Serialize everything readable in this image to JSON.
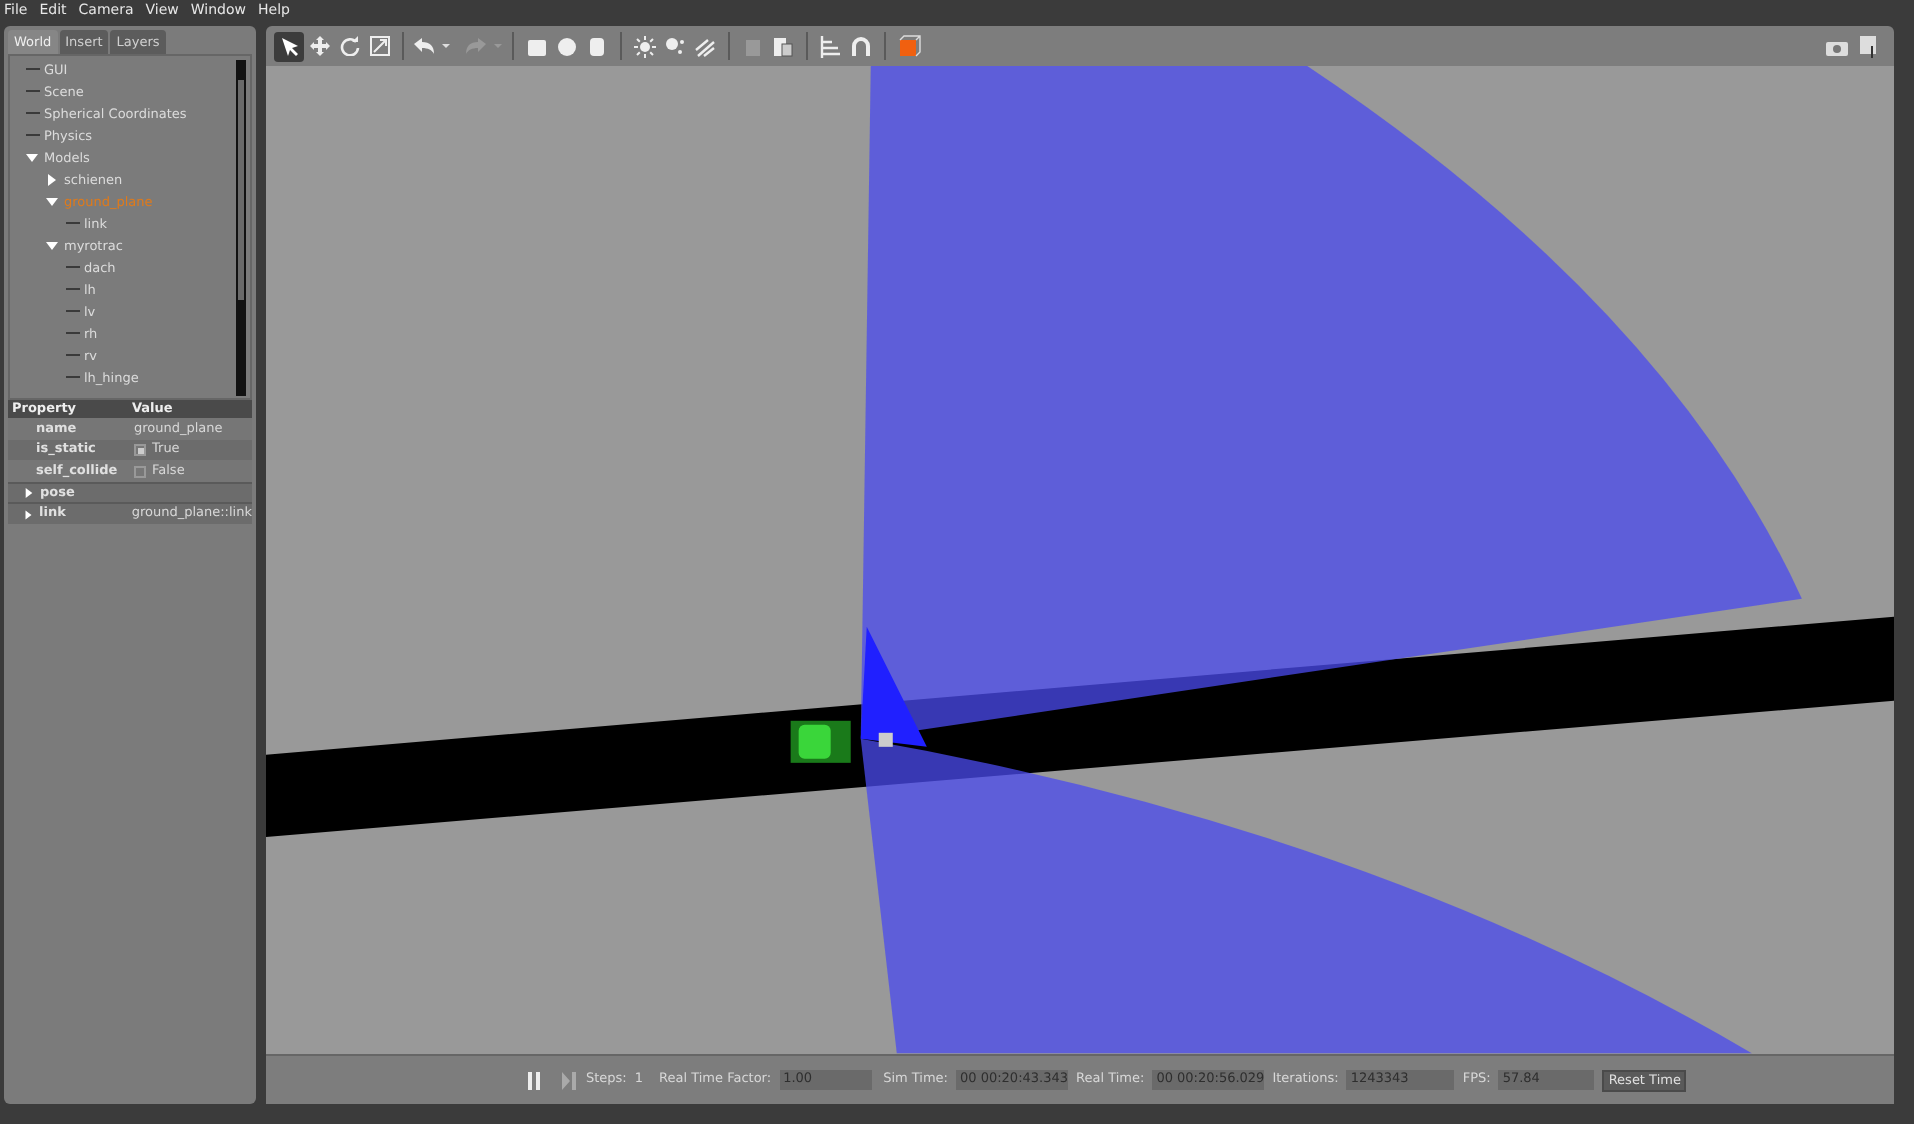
{
  "menu": [
    "File",
    "Edit",
    "Camera",
    "View",
    "Window",
    "Help"
  ],
  "tabs": [
    {
      "label": "World",
      "selected": true
    },
    {
      "label": "Insert",
      "selected": false
    },
    {
      "label": "Layers",
      "selected": false
    }
  ],
  "tree": [
    {
      "label": "GUI",
      "selected": false
    },
    {
      "label": "Scene",
      "selected": false
    },
    {
      "label": "Spherical Coordinates",
      "selected": false
    },
    {
      "label": "Physics",
      "selected": false
    },
    {
      "label": "Models",
      "selected": false,
      "expanded": true,
      "children": [
        {
          "label": "schienen",
          "selected": false,
          "expanded": false
        },
        {
          "label": "ground_plane",
          "selected": true,
          "expanded": true,
          "children": [
            {
              "label": "link",
              "selected": false
            }
          ]
        },
        {
          "label": "myrotrac",
          "selected": false,
          "expanded": true,
          "children": [
            {
              "label": "dach",
              "selected": false
            },
            {
              "label": "lh",
              "selected": false
            },
            {
              "label": "lv",
              "selected": false
            },
            {
              "label": "rh",
              "selected": false
            },
            {
              "label": "rv",
              "selected": false
            },
            {
              "label": "lh_hinge",
              "selected": false
            }
          ]
        }
      ]
    }
  ],
  "properties": {
    "columns": [
      "Property",
      "Value"
    ],
    "rows": [
      {
        "kind": "text",
        "name": "name",
        "value": "ground_plane"
      },
      {
        "kind": "checkbox",
        "name": "is_static",
        "value": "True",
        "checked": true
      },
      {
        "kind": "checkbox",
        "name": "self_collide",
        "value": "False",
        "checked": false
      },
      {
        "kind": "group",
        "name": "pose",
        "expanded": false
      },
      {
        "kind": "group",
        "name": "link",
        "value": "ground_plane::link",
        "expanded": false
      }
    ]
  },
  "tools": [
    {
      "kind": "select",
      "selected": true
    },
    {
      "kind": "translate",
      "selected": false
    },
    {
      "kind": "rotate",
      "selected": false
    },
    {
      "kind": "scale",
      "selected": false
    }
  ],
  "bottom_bar": {
    "paused": false,
    "steps_label": "Steps:",
    "steps": "1",
    "rtf_label": "Real Time Factor:",
    "rtf": "1.00",
    "sim_label": "Sim Time:",
    "sim": "00 00:20:43.343",
    "real_label": "Real Time:",
    "real": "00 00:20:56.029",
    "iter_label": "Iterations:",
    "iter": "1243343",
    "fps_label": "FPS:",
    "fps": "57.84",
    "reset": "Reset Time"
  }
}
